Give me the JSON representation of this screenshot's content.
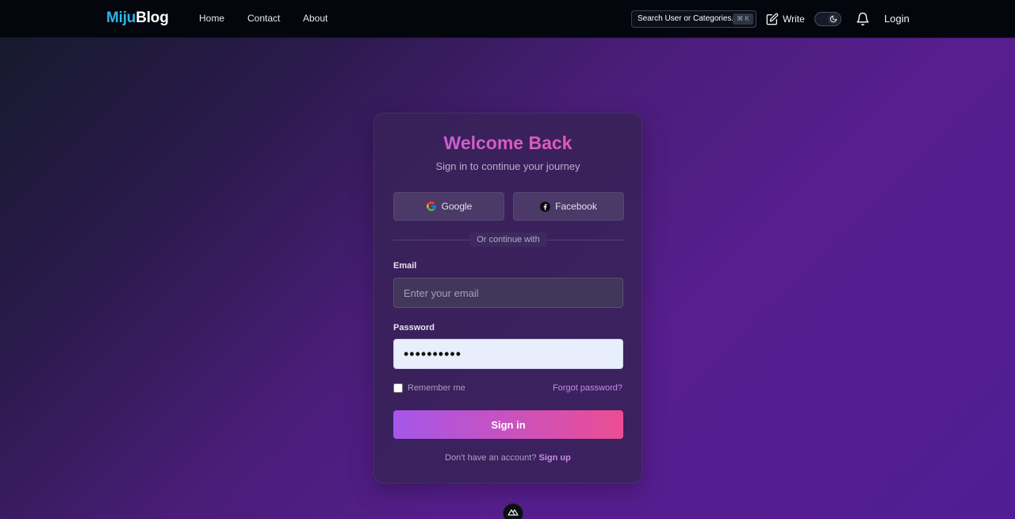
{
  "nav": {
    "logo_part1": "Miju",
    "logo_part2": "Blog",
    "links": [
      "Home",
      "Contact",
      "About"
    ],
    "search_placeholder": "Search User or Categories...",
    "search_shortcut": "⌘ K",
    "write_label": "Write",
    "login_label": "Login"
  },
  "card": {
    "title": "Welcome Back",
    "subtitle": "Sign in to continue your journey",
    "google_label": "Google",
    "facebook_label": "Facebook",
    "divider_text": "Or continue with",
    "email_label": "Email",
    "email_placeholder": "Enter your email",
    "email_value": "",
    "password_label": "Password",
    "password_value": "••••••••••",
    "remember_label": "Remember me",
    "remember_checked": false,
    "forgot_label": "Forgot password?",
    "signin_label": "Sign in",
    "signup_prompt": "Don't have an account?",
    "signup_link": "Sign up"
  },
  "colors": {
    "brand_cyan": "#2fb4e8",
    "accent_purple": "#a557ea",
    "accent_pink": "#ec4d93",
    "link_color": "#c88be4"
  }
}
